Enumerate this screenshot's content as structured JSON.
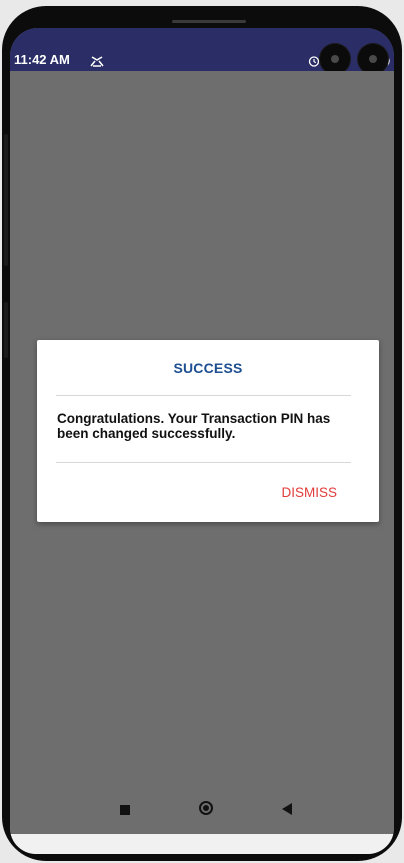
{
  "status_bar": {
    "time": "11:42 AM",
    "icons": [
      "notification-icon",
      "alarm-icon",
      "battery-icon"
    ],
    "background_color": "#2a2d66"
  },
  "dialog": {
    "title": "SUCCESS",
    "message": "Congratulations. Your Transaction PIN has been changed successfully.",
    "dismiss_label": "DISMISS",
    "title_color": "#1d4f91",
    "dismiss_color": "#e13b3b"
  },
  "nav_bar": {
    "icons": [
      "recent-apps-icon",
      "home-icon",
      "back-icon"
    ]
  }
}
